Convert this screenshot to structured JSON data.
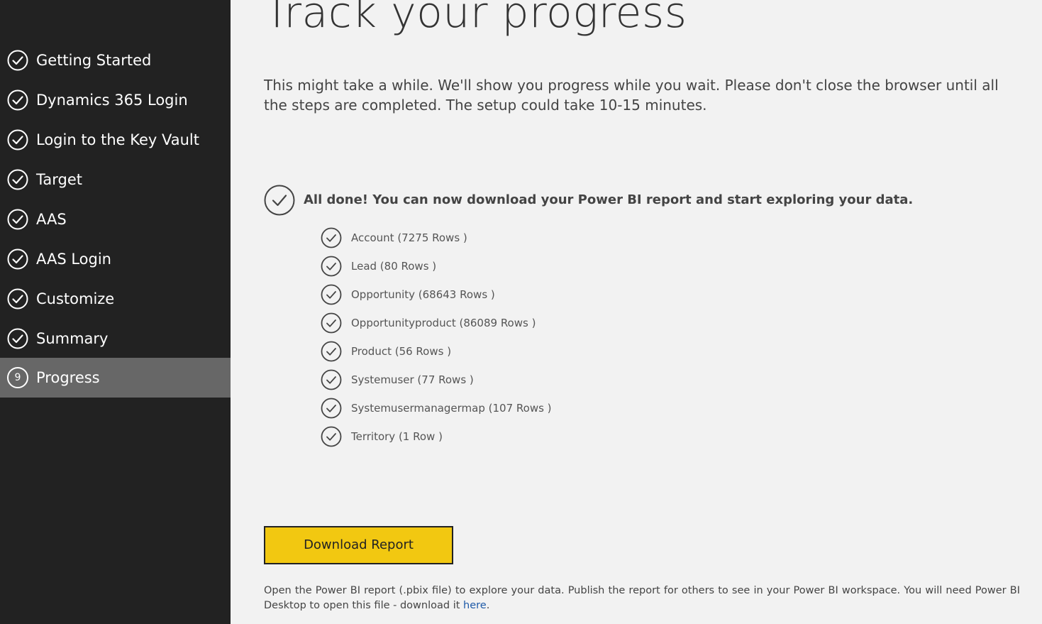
{
  "sidebar": {
    "items": [
      {
        "label": "Getting Started",
        "state": "complete"
      },
      {
        "label": "Dynamics 365 Login",
        "state": "complete"
      },
      {
        "label": "Login to the Key Vault",
        "state": "complete"
      },
      {
        "label": "Target",
        "state": "complete"
      },
      {
        "label": "AAS",
        "state": "complete"
      },
      {
        "label": "AAS Login",
        "state": "complete"
      },
      {
        "label": "Customize",
        "state": "complete"
      },
      {
        "label": "Summary",
        "state": "complete"
      },
      {
        "label": "Progress",
        "state": "active",
        "number": "9"
      }
    ]
  },
  "main": {
    "title": "Track your progress",
    "intro": "This might take a while. We'll show you progress while you wait. Please don't close the browser until all the steps are completed. The setup could take 10-15 minutes.",
    "done_message": "All done! You can now download your Power BI report and start exploring your data.",
    "tables": [
      {
        "label": "Account (7275 Rows )"
      },
      {
        "label": "Lead (80 Rows )"
      },
      {
        "label": "Opportunity (68643 Rows )"
      },
      {
        "label": "Opportunityproduct (86089 Rows )"
      },
      {
        "label": "Product (56 Rows )"
      },
      {
        "label": "Systemuser (77 Rows )"
      },
      {
        "label": "Systemusermanagermap (107 Rows )"
      },
      {
        "label": "Territory (1 Row )"
      }
    ],
    "download_button": "Download Report",
    "footer_text": "Open the Power BI report (.pbix file) to explore your data. Publish the report for others to see in your Power BI workspace. You will need Power BI Desktop to open this file - download it",
    "footer_link": "here",
    "footer_end": "."
  },
  "icons": {
    "step_complete": "check-circle-icon",
    "step_active": "number-circle-icon",
    "done": "check-circle-icon"
  },
  "colors": {
    "sidebar_bg": "#222222",
    "sidebar_active_bg": "#676767",
    "page_bg": "#f2f2f2",
    "button_bg": "#f2c811",
    "link": "#1e5aa8"
  }
}
